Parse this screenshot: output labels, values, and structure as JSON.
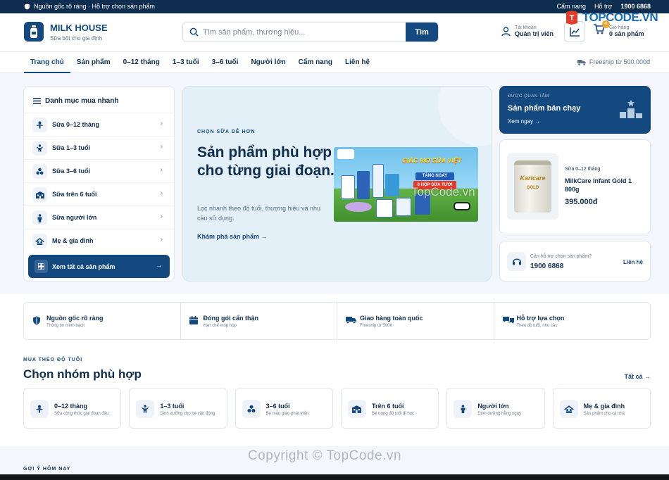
{
  "topbar": {
    "left_text": "Nguồn gốc rõ ràng · Hỗ trợ chọn sản phẩm",
    "links": [
      "Cẩm nang",
      "Hỗ trợ"
    ],
    "hotline": "1900 6868"
  },
  "header": {
    "brand_name": "MILK HOUSE",
    "brand_tagline": "Sữa bột cho gia đình",
    "search_placeholder": "Tìm sản phẩm, thương hiệu...",
    "search_button": "Tìm",
    "account_small": "Tài khoản",
    "account_name": "Quản trị viên",
    "cart_small": "Giỏ hàng",
    "cart_count_text": "0 sản phẩm",
    "cart_badge": "0"
  },
  "watermark_brand": "TOPCODE.VN",
  "nav": {
    "items": [
      "Trang chủ",
      "Sản phẩm",
      "0–12 tháng",
      "1–3 tuổi",
      "3–6 tuổi",
      "Người lớn",
      "Cẩm nang",
      "Liên hệ"
    ],
    "active_index": 0,
    "freeship": "Freeship từ 500.000đ"
  },
  "categories": {
    "heading": "Danh mục mua nhanh",
    "items": [
      {
        "label": "Sữa 0–12 tháng",
        "icon": "baby-icon"
      },
      {
        "label": "Sữa 1–3 tuổi",
        "icon": "toddler-icon"
      },
      {
        "label": "Sữa 3–6 tuổi",
        "icon": "blocks-icon"
      },
      {
        "label": "Sữa trên 6 tuổi",
        "icon": "school-icon"
      },
      {
        "label": "Sữa người lớn",
        "icon": "person-icon"
      },
      {
        "label": "Mẹ & gia đình",
        "icon": "family-icon"
      }
    ],
    "view_all": "Xem tất cả sản phẩm"
  },
  "hero": {
    "eyebrow": "CHỌN SỮA DỄ HƠN",
    "title": "Sản phẩm phù hợp cho từng giai đoạn.",
    "description": "Lọc nhanh theo độ tuổi, thương hiệu và nhu cầu sử dụng.",
    "cta": "Khám phá sản phẩm",
    "banner_headline": "GIẤC MƠ SỮA VIỆT",
    "banner_badge1": "TẶNG NGAY",
    "banner_badge2": "6 HỘP SỮA TƯƠI"
  },
  "watermark_center": "TopCode.vn",
  "bestseller": {
    "eyebrow": "ĐƯỢC QUAN TÂM",
    "title": "Sản phẩm bán chạy",
    "link": "Xem ngay"
  },
  "product": {
    "can_brand": "Karicare",
    "can_grade": "GOLD",
    "category": "Sữa 0–12 tháng",
    "name": "MilkCare Infant Gold 1 800g",
    "price": "395.000đ"
  },
  "support": {
    "question": "Cần hỗ trợ chọn sản phẩm?",
    "phone": "1900 6868",
    "contact": "Liên hệ"
  },
  "features": [
    {
      "title": "Nguồn gốc rõ ràng",
      "sub": "Thông tin minh bạch",
      "icon": "shield-icon"
    },
    {
      "title": "Đóng gói cẩn thận",
      "sub": "Hạn chế móp hộp",
      "icon": "box-icon"
    },
    {
      "title": "Giao hàng toàn quốc",
      "sub": "Freeship từ 500K",
      "icon": "truck-icon"
    },
    {
      "title": "Hỗ trợ lựa chọn",
      "sub": "Theo độ tuổi, nhu cầu",
      "icon": "chat-icon"
    }
  ],
  "groups_section": {
    "eyebrow": "MUA THEO ĐỘ TUỔI",
    "title": "Chọn nhóm phù hợp",
    "all_link": "Tất cả",
    "items": [
      {
        "title": "0–12 tháng",
        "sub": "Sữa công thức giai đoạn đầu",
        "icon": "baby-icon"
      },
      {
        "title": "1–3 tuổi",
        "sub": "Dinh dưỡng cho bé vận động",
        "icon": "toddler-icon"
      },
      {
        "title": "3–6 tuổi",
        "sub": "Bé mẫu giáo phát triển",
        "icon": "blocks-icon"
      },
      {
        "title": "Trên 6 tuổi",
        "sub": "Bé trong độ tuổi đi học",
        "icon": "school-icon"
      },
      {
        "title": "Người lớn",
        "sub": "Dinh dưỡng hằng ngày",
        "icon": "person-icon"
      },
      {
        "title": "Mẹ & gia đình",
        "sub": "Sản phẩm cho cả nhà",
        "icon": "family-icon"
      }
    ]
  },
  "suggest_eyebrow": "GỢI Ý HÔM NAY",
  "copyright_watermark": "Copyright © TopCode.vn",
  "colors": {
    "primary": "#14497f",
    "dark": "#0f2d4e",
    "accent": "#f0a530"
  }
}
